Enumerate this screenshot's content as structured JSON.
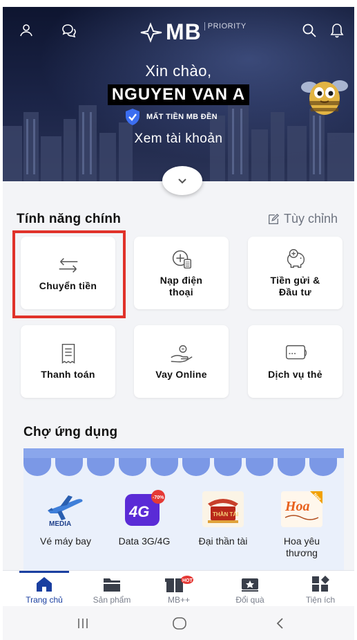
{
  "header": {
    "brand": "MB",
    "brand_tag": "PRIORITY",
    "greeting": "Xin chào,",
    "user_name": "NGUYEN VAN A",
    "warning": "MẤT TIỀN MB ĐỀN",
    "view_account": "Xem tài khoản"
  },
  "features": {
    "title": "Tính năng chính",
    "customize": "Tùy chỉnh",
    "items": [
      {
        "label": "Chuyển tiền",
        "icon": "transfer-icon"
      },
      {
        "label": "Nạp điện thoại",
        "icon": "phone-topup-icon"
      },
      {
        "label": "Tiền gửi & Đầu tư",
        "icon": "piggy-bank-icon"
      },
      {
        "label": "Thanh toán",
        "icon": "bill-icon"
      },
      {
        "label": "Vay Online",
        "icon": "loan-icon"
      },
      {
        "label": "Dịch vụ thẻ",
        "icon": "card-icon"
      }
    ]
  },
  "market": {
    "title": "Chợ ứng dụng",
    "apps": [
      {
        "label": "Vé máy bay",
        "icon": "airplane-icon",
        "logo_text": "MEDIA"
      },
      {
        "label": "Data 3G/4G",
        "icon": "data-4g-icon",
        "logo_text": "4G",
        "badge": "-70%"
      },
      {
        "label": "Đại thần tài",
        "icon": "than-tai-icon",
        "logo_text": "THẦN TÀI"
      },
      {
        "label": "Hoa yêu thương",
        "icon": "flower-icon",
        "logo_text": "Hoa",
        "badge": "New"
      }
    ]
  },
  "bottom_nav": {
    "items": [
      {
        "label": "Trang chủ",
        "icon": "home-icon",
        "active": true
      },
      {
        "label": "Sản phẩm",
        "icon": "folder-icon",
        "active": false
      },
      {
        "label": "MB++",
        "icon": "gift-box-icon",
        "active": false,
        "badge": "HOT"
      },
      {
        "label": "Đổi quà",
        "icon": "ticket-icon",
        "active": false
      },
      {
        "label": "Tiện ích",
        "icon": "utilities-icon",
        "active": false
      }
    ]
  },
  "colors": {
    "header_dark": "#1b2447",
    "brand_blue": "#1a3fa0",
    "highlight_red": "#e0322a",
    "badge_red": "#e53935"
  }
}
